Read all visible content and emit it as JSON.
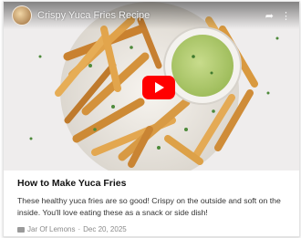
{
  "video": {
    "title": "Crispy Yuca Fries Recipe",
    "share_icon": "share-icon",
    "more_icon": "more-icon",
    "play_icon": "play-icon"
  },
  "post": {
    "title": "How to Make Yuca Fries",
    "excerpt": "These healthy yuca fries are so good! Crispy on the outside and soft on the inside. You'll love eating these as a snack or side dish!",
    "source": "Jar Of Lemons",
    "separator": "·",
    "date": "Dec 20, 2025"
  },
  "colors": {
    "play_button": "#ff0000",
    "sauce": "#b8d07a"
  }
}
